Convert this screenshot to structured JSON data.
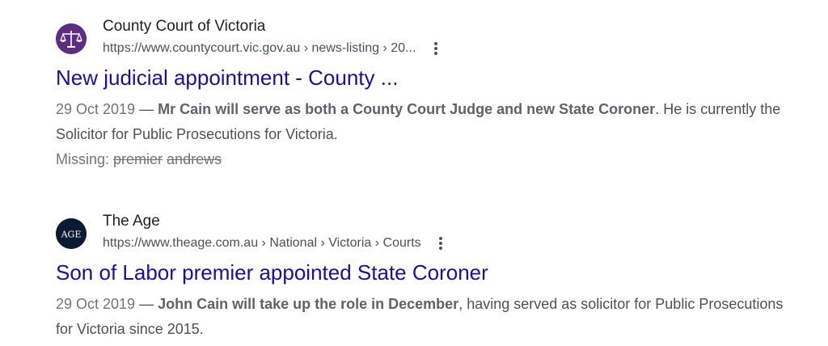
{
  "results": [
    {
      "site_name": "County Court of Victoria",
      "url": "https://www.countycourt.vic.gov.au › news-listing › 20...",
      "favicon": {
        "icon": "scales-of-justice-icon",
        "bg": "#5c2d82"
      },
      "title": "New judicial appointment - County ...",
      "date": "29 Oct 2019",
      "dash": " — ",
      "snippet_bold": "Mr Cain will serve as both a County Court Judge and new State Coroner",
      "snippet_rest": ". He is currently the Solicitor for Public Prosecutions for Victoria.",
      "missing_label": "Missing: ",
      "missing_terms": [
        "premier",
        "andrews"
      ]
    },
    {
      "site_name": "The Age",
      "url": "https://www.theage.com.au › National › Victoria › Courts",
      "favicon": {
        "text": "AGE",
        "bg": "#0a1a33"
      },
      "title": "Son of Labor premier appointed State Coroner",
      "date": "29 Oct 2019",
      "dash": " — ",
      "snippet_bold": "John Cain will take up the role in December",
      "snippet_rest": ", having served as solicitor for Public Prosecutions for Victoria since 2015."
    }
  ],
  "colors": {
    "title_link": "#1a0dab",
    "snippet": "#4d5156",
    "site_name": "#202124"
  }
}
